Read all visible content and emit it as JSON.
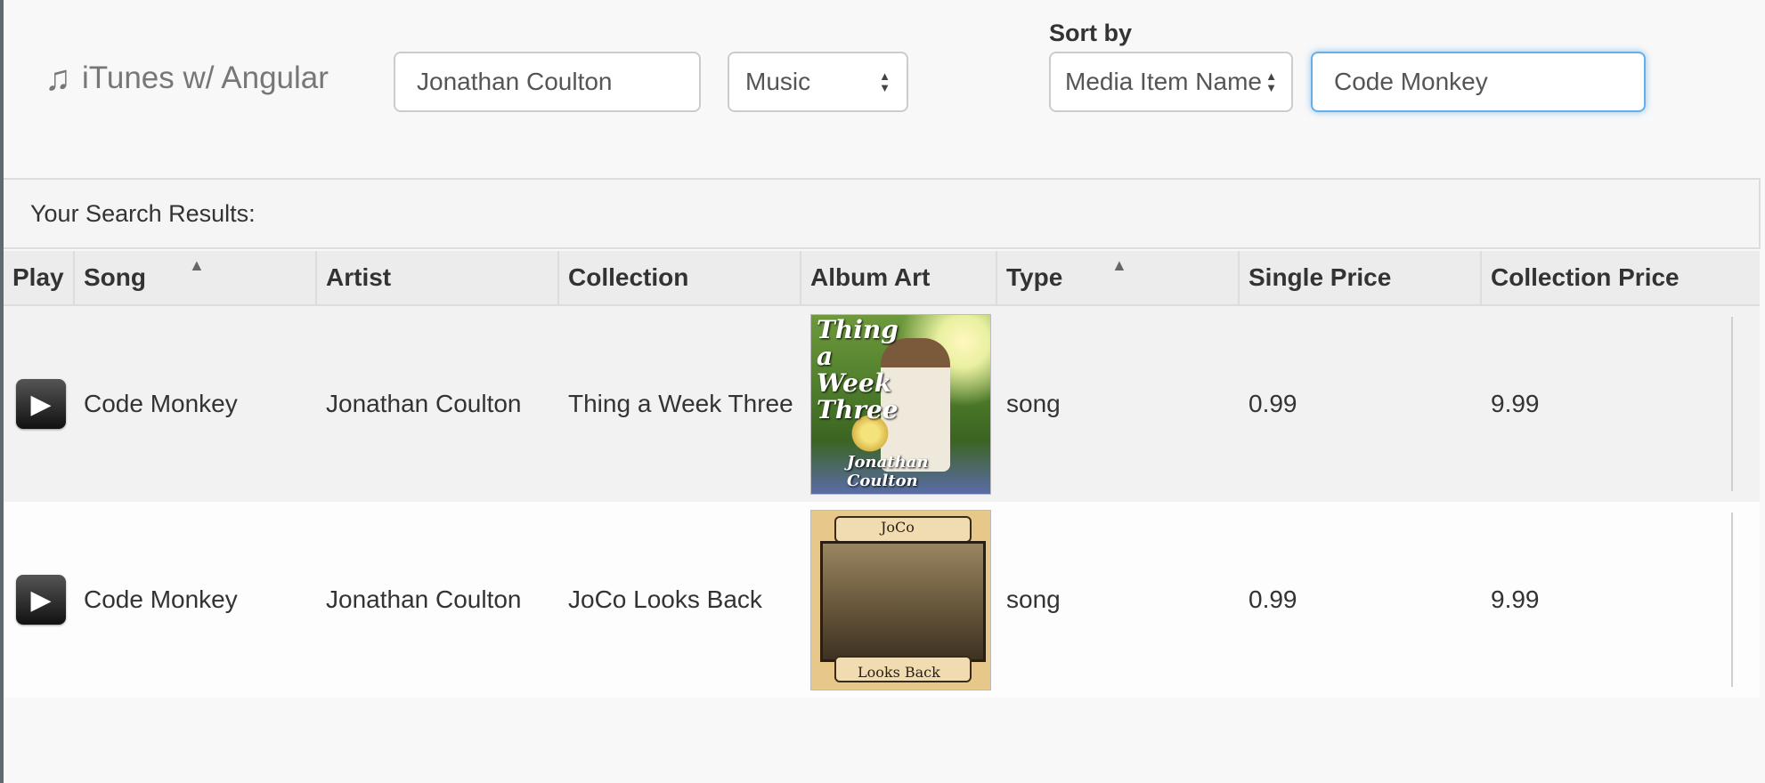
{
  "header": {
    "brand_icon": "music-note-icon",
    "brand_glyph": "♫",
    "brand_title": "iTunes w/ Angular",
    "search_term_value": "Jonathan Coulton",
    "media_select_value": "Music",
    "sort_by_label": "Sort by",
    "sort_select_value": "Media Item Name",
    "filter_value": "Code Monkey"
  },
  "panel": {
    "heading": "Your Search Results:"
  },
  "table": {
    "columns": [
      "Play",
      "Song",
      "Artist",
      "Collection",
      "Album Art",
      "Type",
      "Single Price",
      "Collection Price"
    ],
    "sorted_columns": [
      "Song",
      "Type"
    ],
    "rows": [
      {
        "song": "Code Monkey",
        "artist": "Jonathan Coulton",
        "collection": "Thing a Week Three",
        "art_title": "Thing a Week Three",
        "art_credit": "Jonathan Coulton",
        "type": "song",
        "single_price": "0.99",
        "collection_price": "9.99"
      },
      {
        "song": "Code Monkey",
        "artist": "Jonathan Coulton",
        "collection": "JoCo Looks Back",
        "art_title": "JoCo",
        "art_credit": "Looks Back",
        "type": "song",
        "single_price": "0.99",
        "collection_price": "9.99"
      }
    ]
  },
  "colors": {
    "focus_border": "#66afe9",
    "header_bg": "#ececec",
    "odd_row_bg": "#f2f2f2"
  }
}
